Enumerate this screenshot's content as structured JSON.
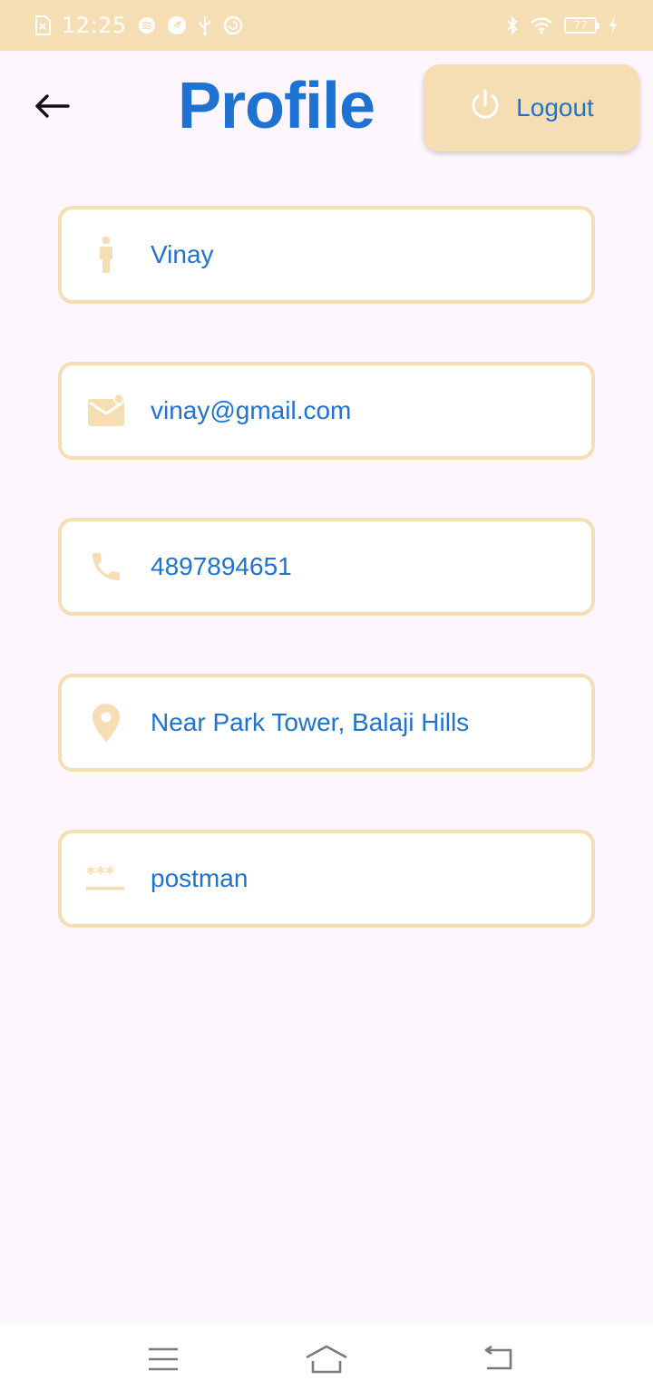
{
  "status_bar": {
    "time": "12:25",
    "battery": "77",
    "left_icons": [
      "sim-blocked-icon",
      "spotify-icon",
      "leaf-icon",
      "usb-icon",
      "sync-icon"
    ],
    "right_icons": [
      "bluetooth-icon",
      "wifi-icon",
      "battery-icon",
      "charging-icon"
    ]
  },
  "header": {
    "back_icon": "arrow-left-icon",
    "title": "Profile",
    "logout_label": "Logout",
    "logout_icon": "power-icon"
  },
  "profile": {
    "fields": [
      {
        "icon": "person-icon",
        "value": "Vinay"
      },
      {
        "icon": "mail-icon",
        "value": "vinay@gmail.com"
      },
      {
        "icon": "phone-icon",
        "value": "4897894651"
      },
      {
        "icon": "location-pin-icon",
        "value": "Near Park Tower, Balaji Hills"
      },
      {
        "icon": "password-icon",
        "value": "postman"
      }
    ]
  },
  "nav": {
    "icons": [
      "menu-icon",
      "home-icon",
      "back-icon"
    ]
  },
  "colors": {
    "accent": "#1e72d2",
    "beige": "#f5deb3",
    "background": "#fdf6fd"
  }
}
